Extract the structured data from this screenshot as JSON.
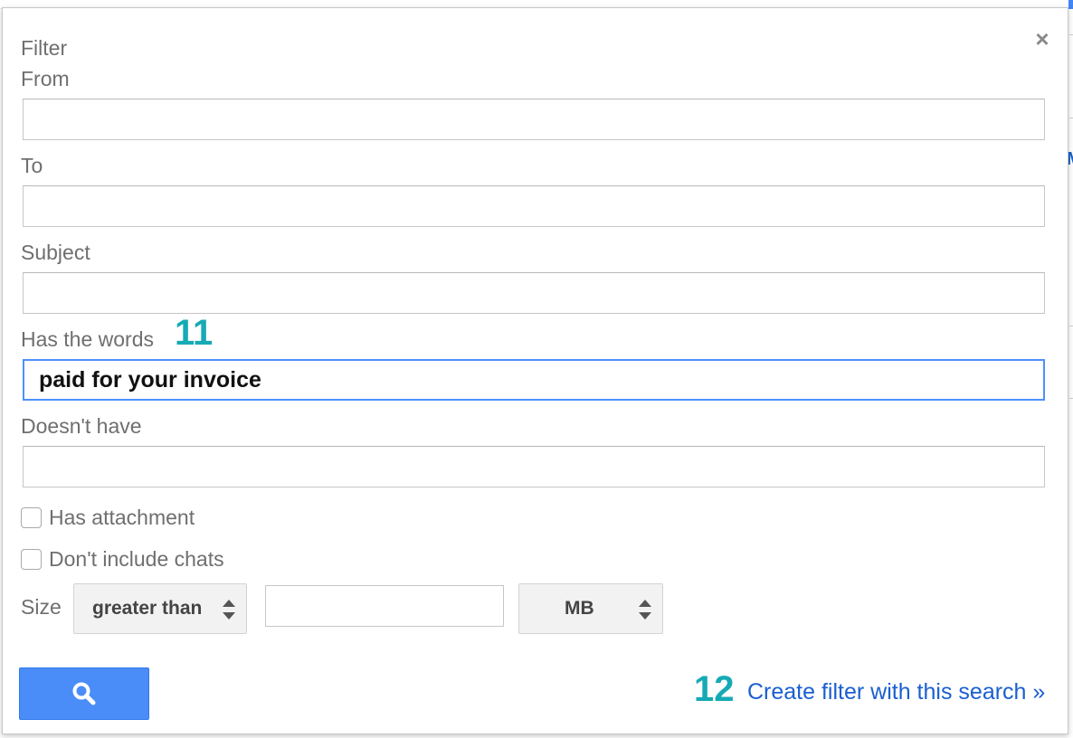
{
  "dialog": {
    "title": "Filter",
    "close_glyph": "×",
    "fields": {
      "from": {
        "label": "From",
        "value": ""
      },
      "to": {
        "label": "To",
        "value": ""
      },
      "subject": {
        "label": "Subject",
        "value": ""
      },
      "has_words": {
        "label": "Has the words",
        "value": "paid for your invoice"
      },
      "doesnt_have": {
        "label": "Doesn't have",
        "value": ""
      }
    },
    "checkboxes": {
      "has_attachment": {
        "label": "Has attachment",
        "checked": false
      },
      "dont_include_chats": {
        "label": "Don't include chats",
        "checked": false
      }
    },
    "size": {
      "label": "Size",
      "comparator": "greater than",
      "value": "",
      "unit": "MB"
    },
    "search_button": {
      "icon": "search-icon"
    },
    "create_filter_link": "Create filter with this search »"
  },
  "annotations": {
    "step_11": "11",
    "step_12": "12"
  },
  "background": {
    "partial_letter": "M"
  },
  "colors": {
    "accent_teal": "#16aab5",
    "button_blue": "#4a8df8",
    "link_blue": "#1a5fd0",
    "focus_blue": "#4d90fe"
  }
}
